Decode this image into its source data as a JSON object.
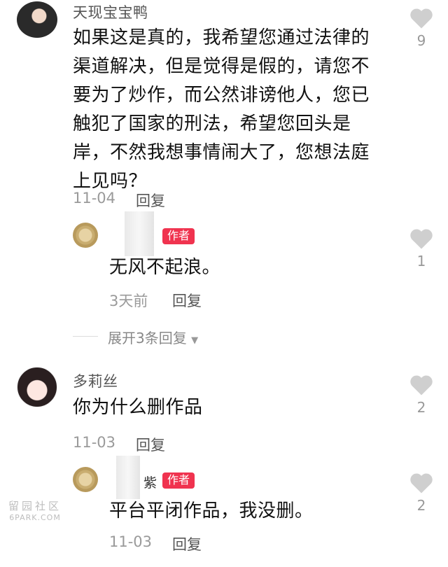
{
  "comments": [
    {
      "username": "天现宝宝鸭",
      "lines": [
        "如果这是真的，我希望您通过法律的",
        "渠道解决，但是觉得是假的，请您不",
        "要为了炒作，而公然诽谤他人，您已",
        "触犯了国家的刑法，希望您回头是",
        "岸，不然我想事情闹大了，您想法庭",
        "上见吗？"
      ],
      "date": "11-04",
      "reply_label": "回复",
      "likes": "9",
      "reply": {
        "badge": "作者",
        "text": "无风不起浪。",
        "date": "3天前",
        "reply_label": "回复",
        "likes": "1"
      },
      "expand_label": "展开3条回复"
    },
    {
      "username": "多莉丝",
      "lines": [
        "你为什么删作品"
      ],
      "date": "11-03",
      "reply_label": "回复",
      "likes": "2",
      "reply": {
        "name_fragment": "紫",
        "badge": "作者",
        "text": "平台平闭作品，我没删。",
        "date": "11-03",
        "reply_label": "回复",
        "likes": "2"
      }
    }
  ],
  "watermark": {
    "line1": "留园社区",
    "line2": "6PARK.COM"
  },
  "colors": {
    "badge": "#f0334f",
    "heart": "#cfcfcf"
  }
}
